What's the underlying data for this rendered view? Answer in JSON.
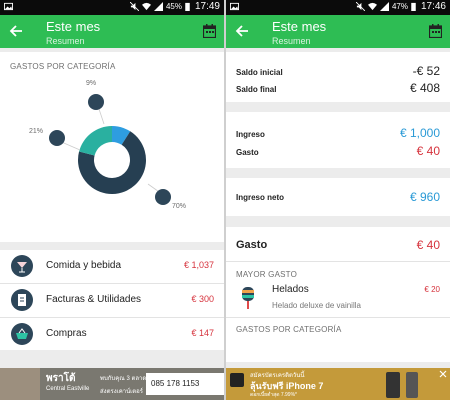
{
  "left": {
    "status": {
      "battery": "45%",
      "time": "17:49"
    },
    "appbar": {
      "title": "Este mes",
      "subtitle": "Resumen"
    },
    "section_label": "GASTOS POR CATEGORÍA",
    "chart_data": {
      "type": "pie",
      "slices": [
        {
          "label": "Comida y bebida",
          "value": 70,
          "color": "#263f52"
        },
        {
          "label": "Facturas & Utilidades",
          "value": 21,
          "color": "#2ab0a0"
        },
        {
          "label": "Compras",
          "value": 9,
          "color": "#2e9de0"
        }
      ],
      "labels": [
        "9%",
        "21%",
        "70%"
      ]
    },
    "categories": [
      {
        "name": "Comida y bebida",
        "amount": "€ 1,037"
      },
      {
        "name": "Facturas & Utilidades",
        "amount": "€ 300"
      },
      {
        "name": "Compras",
        "amount": "€ 147"
      }
    ],
    "ad": {
      "brand": "พราโต้",
      "text1": "ส่งตรงเคาน์เตอร์",
      "text2": "Central Eastville",
      "text3": "พบกับคุณ 3 ตลาด",
      "phone": "085 178 1153"
    }
  },
  "right": {
    "status": {
      "battery": "47%",
      "time": "17:46"
    },
    "appbar": {
      "title": "Este mes",
      "subtitle": "Resumen"
    },
    "saldo_inicial": {
      "label": "Saldo inicial",
      "value": "-€ 52"
    },
    "saldo_final": {
      "label": "Saldo final",
      "value": "€ 408"
    },
    "ingreso": {
      "label": "Ingreso",
      "value": "€ 1,000"
    },
    "gasto": {
      "label": "Gasto",
      "value": "€ 40"
    },
    "ingreso_neto": {
      "label": "Ingreso neto",
      "value": "€ 960"
    },
    "gasto_card": {
      "title": "Gasto",
      "value": "€ 40",
      "mayor_gasto_label": "MAYOR GASTO"
    },
    "mayor_gasto": {
      "name": "Helados",
      "desc": "Helado deluxe de vainilla",
      "amount": "€ 20"
    },
    "section_label": "GASTOS POR CATEGORÍA",
    "ad": {
      "text1": "สมัครบัตรเครดิตวันนี้",
      "text2": "ลุ้นรับฟรี iPhone 7",
      "text3": "ดอกเบี้ยต่ำสุด 7.99%*"
    }
  },
  "colors": {
    "green": "#2ebd54",
    "red": "#d6333d",
    "blue": "#2a9ad6"
  }
}
